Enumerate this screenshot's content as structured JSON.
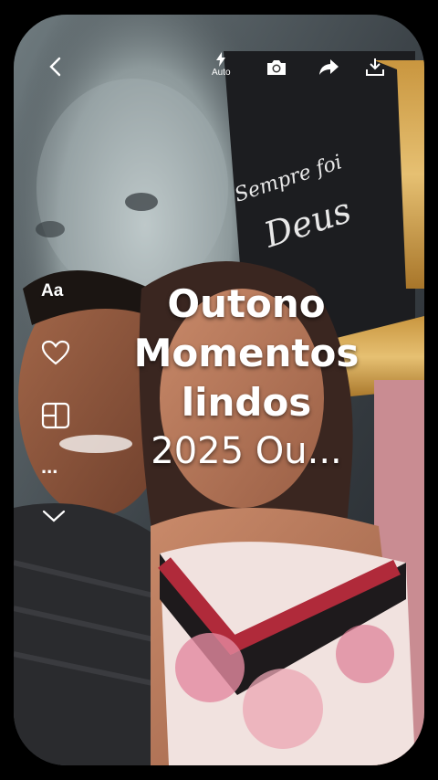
{
  "topbar": {
    "back_icon": "chevron-left-icon",
    "flash_icon": "flash-icon",
    "flash_label": "Auto",
    "camera_icon": "camera-icon",
    "share_icon": "share-icon",
    "download_icon": "download-icon"
  },
  "sidebar": {
    "text_tool_label": "Aa",
    "like_icon": "heart-icon",
    "layout_icon": "layout-grid-icon",
    "more_label": "...",
    "expand_icon": "chevron-down-icon"
  },
  "caption": {
    "line1": "Outono",
    "line2": "Momentos",
    "line3": "lindos",
    "line4": "2025 Ou..."
  },
  "photo": {
    "sign_line1": "Sempre foi",
    "sign_line2": "Deus"
  }
}
